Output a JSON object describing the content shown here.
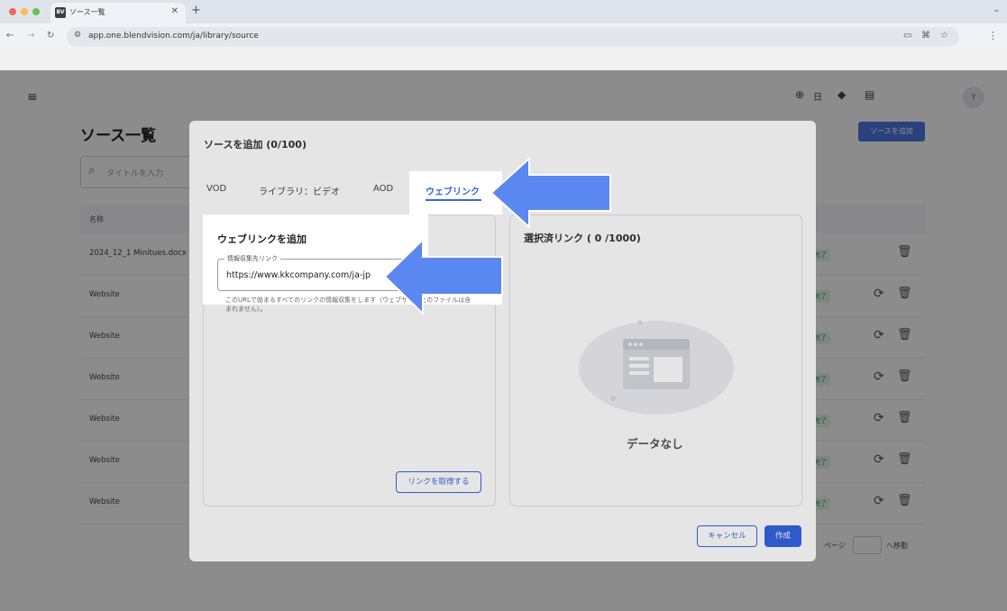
{
  "browser": {
    "tab_title": "ソース一覧",
    "favicon_text": "BV",
    "url": "app.one.blendvision.com/ja/library/source"
  },
  "header": {
    "language_label": "日",
    "avatar_initial": "Y"
  },
  "page": {
    "title": "ソース一覧",
    "add_source_button": "ソースを追加",
    "search_placeholder": "タイトルを入力",
    "column_name": "名称",
    "rows": [
      {
        "name": "2024_12_1 Minitues.docx",
        "status": "完了"
      },
      {
        "name": "Website",
        "status": "完了"
      },
      {
        "name": "Website",
        "status": "完了"
      },
      {
        "name": "Website",
        "status": "完了"
      },
      {
        "name": "Website",
        "status": "完了"
      },
      {
        "name": "Website",
        "status": "完了"
      },
      {
        "name": "Website",
        "status": "完了"
      }
    ],
    "pager_label": "ページ",
    "pager_go": "へ移動"
  },
  "modal": {
    "title": "ソースを追加 (0/100)",
    "tabs": [
      {
        "label": "VOD"
      },
      {
        "label": "ライブラリ：ビデオ"
      },
      {
        "label": "AOD"
      },
      {
        "label": "ウェブリンク"
      }
    ],
    "active_tab_index": 3,
    "left": {
      "heading": "ウェブリンクを追加",
      "field_label": "情報収集先リンク",
      "field_value": "https://www.kkcompany.com/ja-jp",
      "hint": "このURLで始まるすべてのリンクの情報収集をします（ウェブサイト上のファイルは含まれません）。",
      "fetch_button": "リンクを取得する"
    },
    "right": {
      "heading": "選択済リンク ( 0 /1000)",
      "empty_text": "データなし"
    },
    "cancel_button": "キャンセル",
    "create_button": "作成"
  },
  "colors": {
    "accent": "#3565e0",
    "arrow": "#5b87f0",
    "success": "#2e9d57"
  }
}
